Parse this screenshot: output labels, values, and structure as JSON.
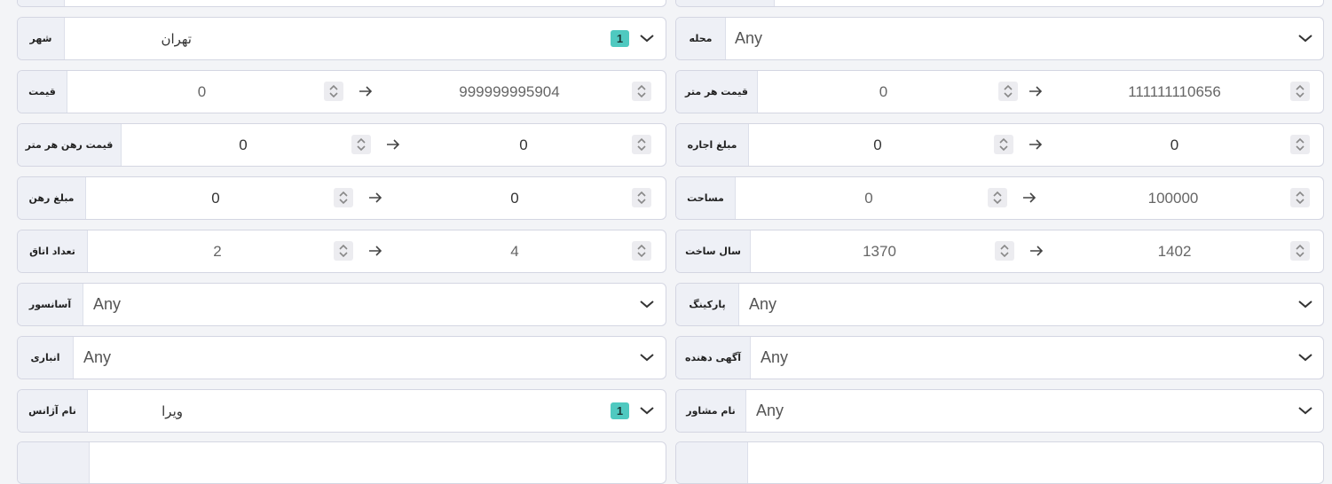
{
  "rows": {
    "city": {
      "label": "شهر",
      "value": "تهران",
      "badge": "1"
    },
    "neighborhood": {
      "label": "محله",
      "value": "Any"
    },
    "price": {
      "label": "قیمت",
      "from": "0",
      "to": "999999995904"
    },
    "price_per_meter": {
      "label": "قیمت هر متر",
      "from": "0",
      "to": "111111110656"
    },
    "deposit_per_meter": {
      "label": "قیمت رهن هر متر",
      "from": "0",
      "to": "0"
    },
    "rent": {
      "label": "مبلغ اجاره",
      "from": "0",
      "to": "0"
    },
    "deposit": {
      "label": "مبلغ رهن",
      "from": "0",
      "to": "0"
    },
    "area": {
      "label": "مساحت",
      "from": "0",
      "to": "100000"
    },
    "rooms": {
      "label": "تعداد اتاق",
      "from": "2",
      "to": "4"
    },
    "build_year": {
      "label": "سال ساخت",
      "from": "1370",
      "to": "1402"
    },
    "elevator": {
      "label": "آسانسور",
      "value": "Any"
    },
    "parking": {
      "label": "پارکینگ",
      "value": "Any"
    },
    "storage": {
      "label": "انباری",
      "value": "Any"
    },
    "advertiser": {
      "label": "آگهی دهنده",
      "value": "Any"
    },
    "agency": {
      "label": "نام آژانس",
      "value": "ویرا",
      "badge": "1"
    },
    "consultant": {
      "label": "نام مشاور",
      "value": "Any"
    }
  },
  "icons": {
    "chevron": "chevron-down-icon",
    "arrow": "arrow-right-icon",
    "spinner": "up-down-spinner-icon"
  },
  "colors": {
    "badge": "#4fc9c0",
    "label_bg": "#eef0f6",
    "border": "#d4d6e2"
  }
}
